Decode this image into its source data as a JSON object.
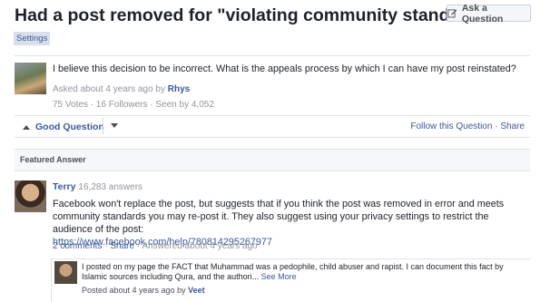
{
  "question": {
    "title": "Had a post removed for \"violating community standards.\"",
    "ask_button_label": "Ask a Question",
    "tag": "Settings",
    "text": "I believe this decision to be incorrect. What is the appeals process by which I can have my post reinstated?",
    "asked_prefix": "Asked about 4 years ago by ",
    "author": "Rhys",
    "stats": "75 Votes · 16 Followers · Seen by 4,052"
  },
  "actions": {
    "good_question": "Good Question",
    "follow": "Follow this Question",
    "separator": " · ",
    "share": "Share"
  },
  "featured": {
    "label": "Featured Answer",
    "answerer": "Terry",
    "answer_count": "16,283 answers",
    "body": "Facebook won't replace the post, but suggests that if you think the post was removed in error and meets community standards you may re-post it. They also suggest using your privacy settings to restrict the audience of the post:",
    "link": "https://www.facebook.com/help/780814295267977",
    "comments": "2 comments",
    "share": "Share",
    "answered": "Answered about 4 years ago"
  },
  "comment": {
    "text": "I posted on my page the FACT that Muhammad was a pedophile, child abuser and rapist. I can document this fact by Islamic sources including Qura, and the authori...",
    "see_more": "See More",
    "posted_prefix": "Posted about 4 years ago by ",
    "author": "Veet"
  }
}
